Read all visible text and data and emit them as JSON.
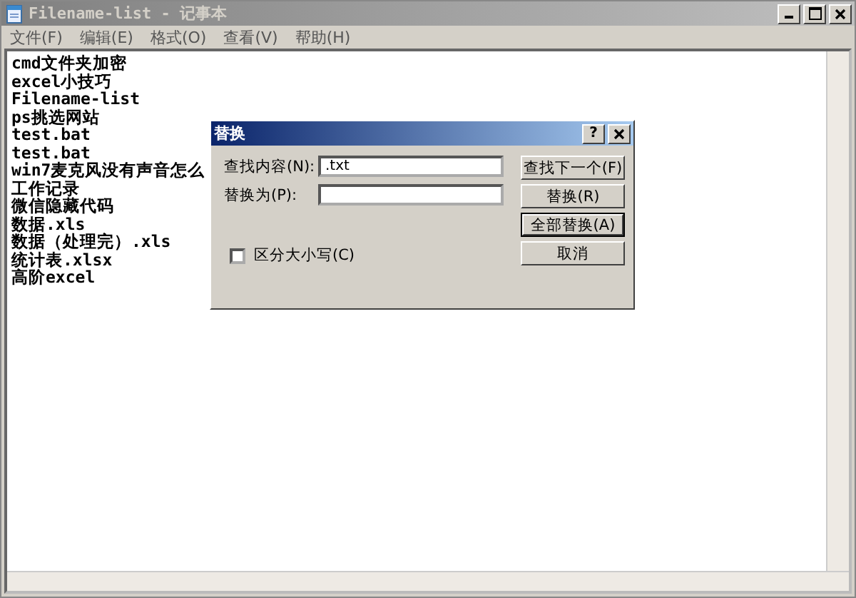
{
  "window": {
    "title": "Filename-list - 记事本",
    "active": false
  },
  "menu": [
    {
      "label": "文件(F)"
    },
    {
      "label": "编辑(E)"
    },
    {
      "label": "格式(O)"
    },
    {
      "label": "查看(V)"
    },
    {
      "label": "帮助(H)"
    }
  ],
  "editor": {
    "lines": [
      "cmd文件夹加密",
      "excel小技巧",
      "Filename-list",
      "ps挑选网站",
      "test.bat",
      "test.bat",
      "win7麦克风没有声音怎么",
      "工作记录",
      "微信隐藏代码",
      "数据.xls",
      "数据（处理完）.xls",
      "统计表.xlsx",
      "高阶excel"
    ]
  },
  "dialog": {
    "title": "替换",
    "help": "?",
    "find_label": "查找内容(N):",
    "find_value": ".txt",
    "replace_label": "替换为(P):",
    "match_case": {
      "label": "区分大小写(C)",
      "checked": false
    },
    "buttons": [
      {
        "label": "查找下一个(F)",
        "focused": false
      },
      {
        "label": "替换(R)",
        "focused": false
      },
      {
        "label": "全部替换(A)",
        "focused": true
      },
      {
        "label": "取消",
        "focused": false
      }
    ]
  }
}
